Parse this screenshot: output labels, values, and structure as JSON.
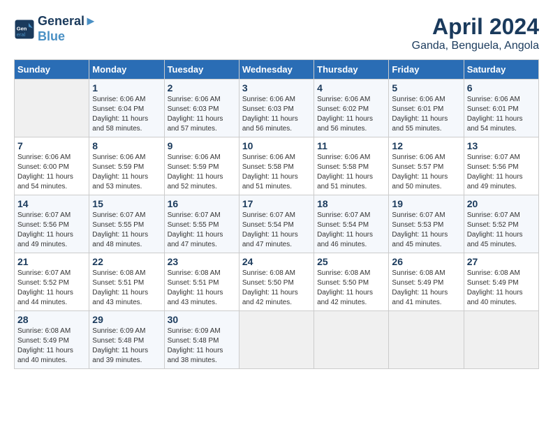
{
  "header": {
    "logo_line1": "General",
    "logo_line2": "Blue",
    "month_title": "April 2024",
    "location": "Ganda, Benguela, Angola"
  },
  "weekdays": [
    "Sunday",
    "Monday",
    "Tuesday",
    "Wednesday",
    "Thursday",
    "Friday",
    "Saturday"
  ],
  "weeks": [
    [
      {
        "day": "",
        "info": ""
      },
      {
        "day": "1",
        "info": "Sunrise: 6:06 AM\nSunset: 6:04 PM\nDaylight: 11 hours\nand 58 minutes."
      },
      {
        "day": "2",
        "info": "Sunrise: 6:06 AM\nSunset: 6:03 PM\nDaylight: 11 hours\nand 57 minutes."
      },
      {
        "day": "3",
        "info": "Sunrise: 6:06 AM\nSunset: 6:03 PM\nDaylight: 11 hours\nand 56 minutes."
      },
      {
        "day": "4",
        "info": "Sunrise: 6:06 AM\nSunset: 6:02 PM\nDaylight: 11 hours\nand 56 minutes."
      },
      {
        "day": "5",
        "info": "Sunrise: 6:06 AM\nSunset: 6:01 PM\nDaylight: 11 hours\nand 55 minutes."
      },
      {
        "day": "6",
        "info": "Sunrise: 6:06 AM\nSunset: 6:01 PM\nDaylight: 11 hours\nand 54 minutes."
      }
    ],
    [
      {
        "day": "7",
        "info": "Sunrise: 6:06 AM\nSunset: 6:00 PM\nDaylight: 11 hours\nand 54 minutes."
      },
      {
        "day": "8",
        "info": "Sunrise: 6:06 AM\nSunset: 5:59 PM\nDaylight: 11 hours\nand 53 minutes."
      },
      {
        "day": "9",
        "info": "Sunrise: 6:06 AM\nSunset: 5:59 PM\nDaylight: 11 hours\nand 52 minutes."
      },
      {
        "day": "10",
        "info": "Sunrise: 6:06 AM\nSunset: 5:58 PM\nDaylight: 11 hours\nand 51 minutes."
      },
      {
        "day": "11",
        "info": "Sunrise: 6:06 AM\nSunset: 5:58 PM\nDaylight: 11 hours\nand 51 minutes."
      },
      {
        "day": "12",
        "info": "Sunrise: 6:06 AM\nSunset: 5:57 PM\nDaylight: 11 hours\nand 50 minutes."
      },
      {
        "day": "13",
        "info": "Sunrise: 6:07 AM\nSunset: 5:56 PM\nDaylight: 11 hours\nand 49 minutes."
      }
    ],
    [
      {
        "day": "14",
        "info": "Sunrise: 6:07 AM\nSunset: 5:56 PM\nDaylight: 11 hours\nand 49 minutes."
      },
      {
        "day": "15",
        "info": "Sunrise: 6:07 AM\nSunset: 5:55 PM\nDaylight: 11 hours\nand 48 minutes."
      },
      {
        "day": "16",
        "info": "Sunrise: 6:07 AM\nSunset: 5:55 PM\nDaylight: 11 hours\nand 47 minutes."
      },
      {
        "day": "17",
        "info": "Sunrise: 6:07 AM\nSunset: 5:54 PM\nDaylight: 11 hours\nand 47 minutes."
      },
      {
        "day": "18",
        "info": "Sunrise: 6:07 AM\nSunset: 5:54 PM\nDaylight: 11 hours\nand 46 minutes."
      },
      {
        "day": "19",
        "info": "Sunrise: 6:07 AM\nSunset: 5:53 PM\nDaylight: 11 hours\nand 45 minutes."
      },
      {
        "day": "20",
        "info": "Sunrise: 6:07 AM\nSunset: 5:52 PM\nDaylight: 11 hours\nand 45 minutes."
      }
    ],
    [
      {
        "day": "21",
        "info": "Sunrise: 6:07 AM\nSunset: 5:52 PM\nDaylight: 11 hours\nand 44 minutes."
      },
      {
        "day": "22",
        "info": "Sunrise: 6:08 AM\nSunset: 5:51 PM\nDaylight: 11 hours\nand 43 minutes."
      },
      {
        "day": "23",
        "info": "Sunrise: 6:08 AM\nSunset: 5:51 PM\nDaylight: 11 hours\nand 43 minutes."
      },
      {
        "day": "24",
        "info": "Sunrise: 6:08 AM\nSunset: 5:50 PM\nDaylight: 11 hours\nand 42 minutes."
      },
      {
        "day": "25",
        "info": "Sunrise: 6:08 AM\nSunset: 5:50 PM\nDaylight: 11 hours\nand 42 minutes."
      },
      {
        "day": "26",
        "info": "Sunrise: 6:08 AM\nSunset: 5:49 PM\nDaylight: 11 hours\nand 41 minutes."
      },
      {
        "day": "27",
        "info": "Sunrise: 6:08 AM\nSunset: 5:49 PM\nDaylight: 11 hours\nand 40 minutes."
      }
    ],
    [
      {
        "day": "28",
        "info": "Sunrise: 6:08 AM\nSunset: 5:49 PM\nDaylight: 11 hours\nand 40 minutes."
      },
      {
        "day": "29",
        "info": "Sunrise: 6:09 AM\nSunset: 5:48 PM\nDaylight: 11 hours\nand 39 minutes."
      },
      {
        "day": "30",
        "info": "Sunrise: 6:09 AM\nSunset: 5:48 PM\nDaylight: 11 hours\nand 38 minutes."
      },
      {
        "day": "",
        "info": ""
      },
      {
        "day": "",
        "info": ""
      },
      {
        "day": "",
        "info": ""
      },
      {
        "day": "",
        "info": ""
      }
    ]
  ]
}
